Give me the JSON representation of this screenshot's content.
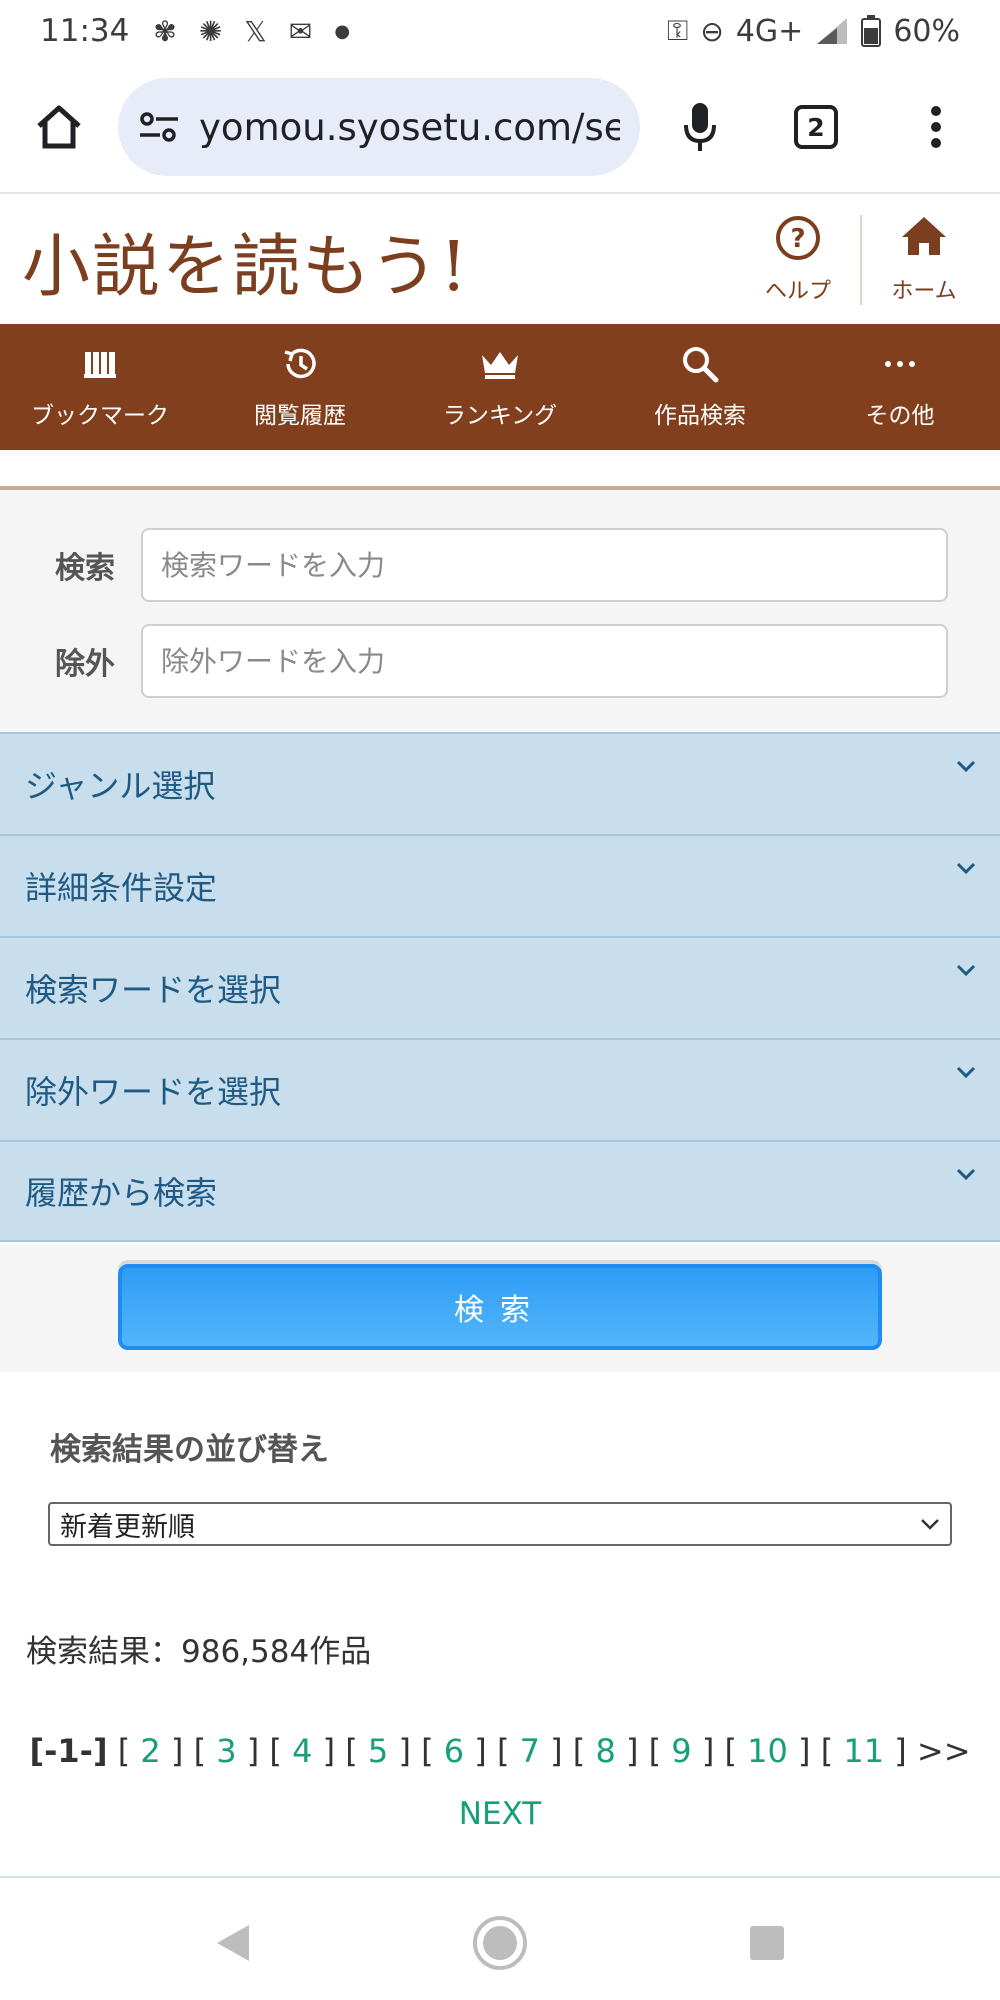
{
  "status_bar": {
    "time": "11:34",
    "notif_icons": [
      "pinwheel-app-icon",
      "loading-circle-icon",
      "x-app-icon",
      "mail-icon",
      "dot-icon"
    ],
    "network": "4G+",
    "battery": "60%"
  },
  "browser": {
    "url": "yomou.syosetu.com/sea",
    "tab_count": "2"
  },
  "site": {
    "logo": "小説を読もう!",
    "help_label": "ヘルプ",
    "home_label": "ホーム"
  },
  "nav": {
    "items": [
      {
        "label": "ブックマーク",
        "icon": "bookshelf-icon"
      },
      {
        "label": "閲覧履歴",
        "icon": "history-icon"
      },
      {
        "label": "ランキング",
        "icon": "crown-icon"
      },
      {
        "label": "作品検索",
        "icon": "search-icon"
      },
      {
        "label": "その他",
        "icon": "more-icon"
      }
    ]
  },
  "search": {
    "keyword_label": "検索",
    "keyword_placeholder": "検索ワードを入力",
    "exclude_label": "除外",
    "exclude_placeholder": "除外ワードを入力",
    "submit_label": "検索"
  },
  "accordion": {
    "items": [
      {
        "label": "ジャンル選択"
      },
      {
        "label": "詳細条件設定"
      },
      {
        "label": "検索ワードを選択"
      },
      {
        "label": "除外ワードを選択"
      },
      {
        "label": "履歴から検索"
      }
    ]
  },
  "sort": {
    "title": "検索結果の並び替え",
    "selected": "新着更新順"
  },
  "results": {
    "text": "検索結果：986,584作品"
  },
  "pagination": {
    "current": "[-1-]",
    "pages": [
      "2",
      "3",
      "4",
      "5",
      "6",
      "7",
      "8",
      "9",
      "10",
      "11"
    ],
    "more": ">>",
    "next": "NEXT"
  },
  "colors": {
    "brand_brown": "#823f1d",
    "accordion_bg": "#c8deec",
    "accordion_text": "#1f5a85",
    "button_blue": "#2f9cf5",
    "link_green": "#17a078"
  }
}
